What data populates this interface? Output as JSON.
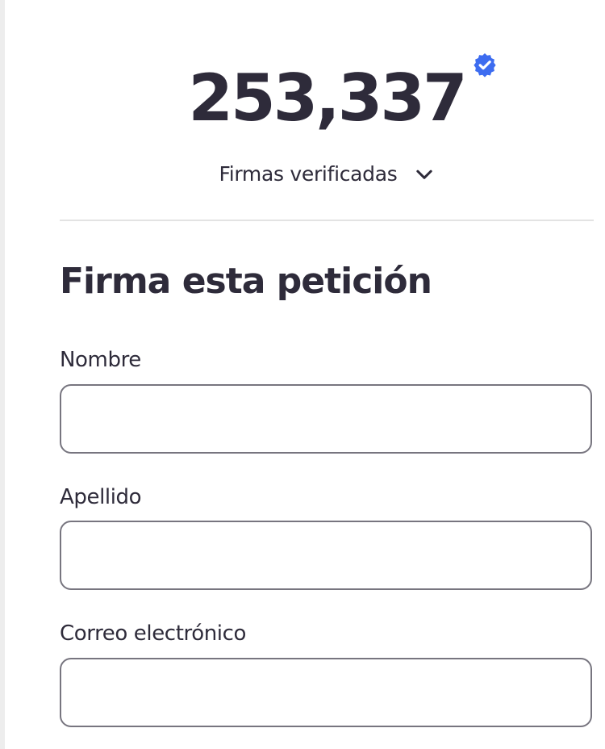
{
  "signatures": {
    "count": "253,337",
    "verified_toggle_label": "Firmas verificadas"
  },
  "form": {
    "title": "Firma esta petición",
    "fields": {
      "first_name": {
        "label": "Nombre",
        "value": "",
        "placeholder": ""
      },
      "last_name": {
        "label": "Apellido",
        "value": "",
        "placeholder": ""
      },
      "email": {
        "label": "Correo electrónico",
        "value": "",
        "placeholder": ""
      }
    }
  },
  "icons": {
    "verified": "verified-badge-icon",
    "chevron": "chevron-down-icon"
  },
  "colors": {
    "text": "#2e2b3a",
    "badge": "#3d6cf0",
    "input_border": "#77757f",
    "divider": "#e3e3e3"
  }
}
